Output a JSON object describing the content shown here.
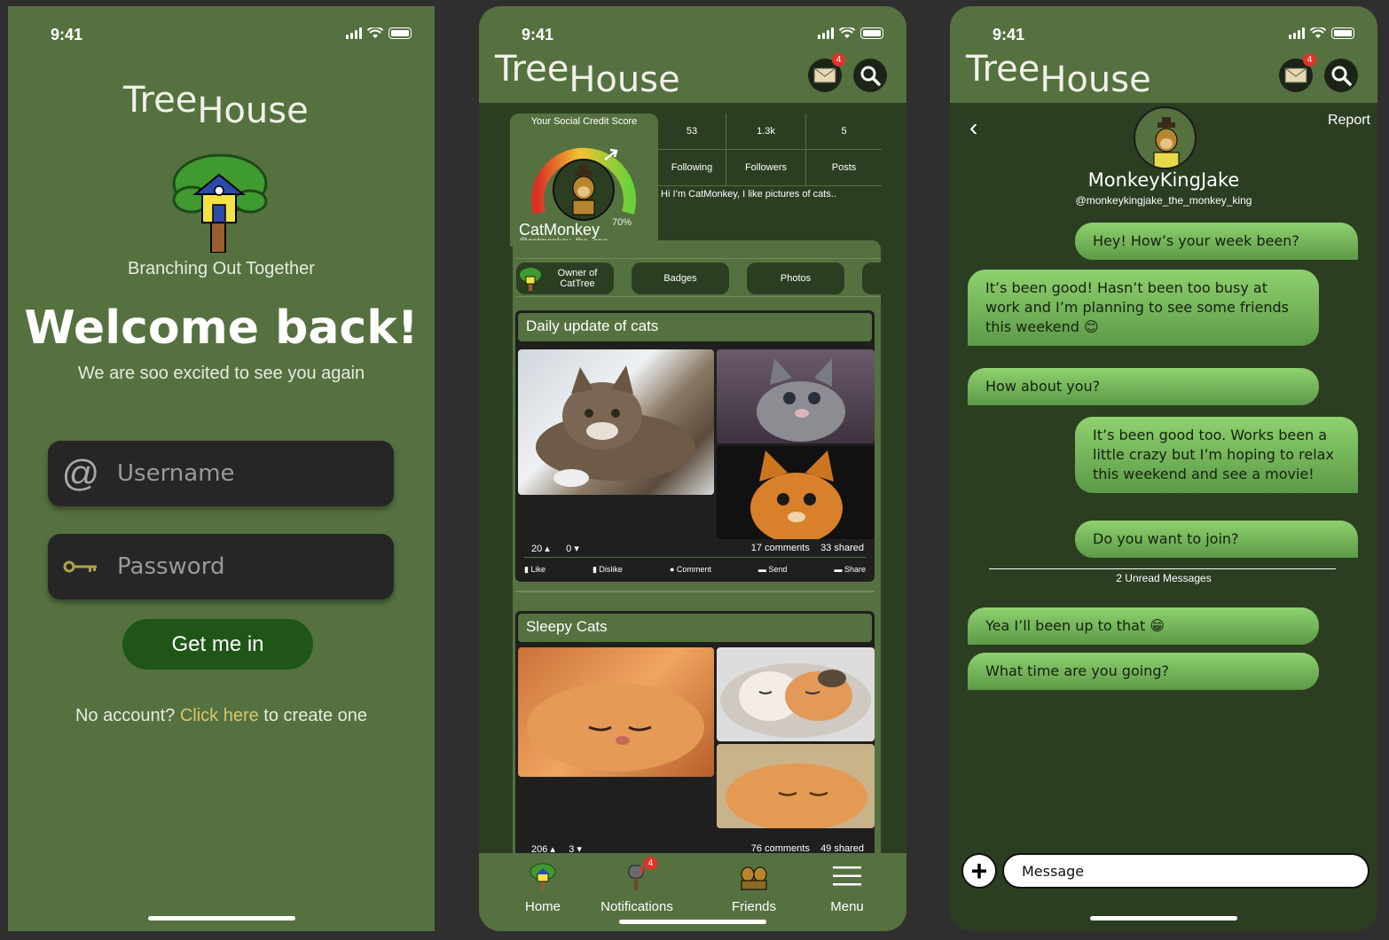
{
  "status": {
    "time": "9:41"
  },
  "brand": {
    "name_part1": "Tree",
    "name_part2": "House"
  },
  "login": {
    "tagline": "Branching Out Together",
    "welcome": "Welcome back!",
    "subtitle": "We are soo excited to see you again",
    "username_placeholder": "Username",
    "password_placeholder": "Password",
    "submit_label": "Get me in",
    "no_account_prefix": "No account?",
    "no_account_link": "Click here",
    "no_account_suffix": "to create one"
  },
  "header": {
    "mail_badge": "4",
    "mail_icon": "mail-icon",
    "search_icon": "search-icon"
  },
  "profile": {
    "score_label": "Your Social Credit Score",
    "score_percent": "70%",
    "score_value": 0.7,
    "username": "CatMonkey",
    "handle": "@catmonkey_the_ape",
    "stats": [
      {
        "value": "53",
        "label": "Following"
      },
      {
        "value": "1.3k",
        "label": "Followers"
      },
      {
        "value": "5",
        "label": "Posts"
      }
    ],
    "bio": "Hi I’m CatMonkey, I like pictures of cats..",
    "chips": [
      "Owner of CatTree",
      "Badges",
      "Photos"
    ]
  },
  "posts": [
    {
      "title": "Daily update of cats",
      "likes": "20",
      "dislikes": "0",
      "comments": "17 comments",
      "shared": "33 shared"
    },
    {
      "title": "Sleepy Cats",
      "likes": "206",
      "dislikes": "3",
      "comments": "76 comments",
      "shared": "49 shared"
    }
  ],
  "post_actions": [
    "Like",
    "Dislike",
    "Comment",
    "Send",
    "Share"
  ],
  "tabs": [
    {
      "label": "Home",
      "icon": "treehouse-icon"
    },
    {
      "label": "Notifications",
      "icon": "mailbox-icon",
      "badge": "4"
    },
    {
      "label": "Friends",
      "icon": "friends-icon"
    },
    {
      "label": "Menu",
      "icon": "menu-icon"
    }
  ],
  "chat": {
    "report_label": "Report",
    "contact_name": "MonkeyKingJake",
    "contact_handle": "@monkeykingjake_the_monkey_king",
    "messages": [
      {
        "from": "me",
        "text": "Hey! How’s your week been?"
      },
      {
        "from": "them",
        "text": "It’s been good! Hasn’t been too busy at work and I’m planning to see some friends this weekend 😊"
      },
      {
        "from": "them",
        "text": "How about you?"
      },
      {
        "from": "me",
        "text": "It’s been good too. Works been a little crazy but I’m hoping to relax this weekend and see a movie!"
      },
      {
        "from": "me",
        "text": "Do you want to join?"
      },
      {
        "from": "them",
        "text": "Yea I’ll been up to that 😁"
      },
      {
        "from": "them",
        "text": "What time are you going?"
      }
    ],
    "unread_label": "2 Unread Messages",
    "input_placeholder": "Message"
  },
  "colors": {
    "primary_green": "#557140",
    "dark_green": "#2c3e22",
    "button_green": "#1f5517",
    "link_yellow": "#d8c66a",
    "badge_red": "#e0332b"
  }
}
